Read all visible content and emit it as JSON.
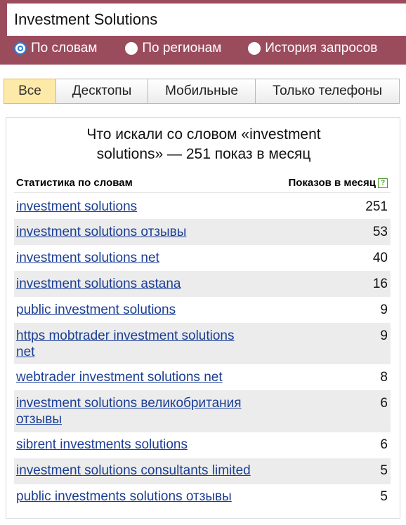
{
  "search": {
    "value": "Investment Solutions",
    "options": [
      {
        "label": "По словам",
        "checked": true
      },
      {
        "label": "По регионам",
        "checked": false
      },
      {
        "label": "История запросов",
        "checked": false
      }
    ]
  },
  "tabs": [
    {
      "label": "Все",
      "active": true
    },
    {
      "label": "Десктопы",
      "active": false
    },
    {
      "label": "Мобильные",
      "active": false
    },
    {
      "label": "Только телефоны",
      "active": false
    }
  ],
  "panel": {
    "title_line1": "Что искали со словом «investment",
    "title_line2": "solutions» — 251 показ в месяц",
    "col_left": "Статистика по словам",
    "col_right": "Показов в месяц",
    "help_icon": "question-icon",
    "help_glyph": "?"
  },
  "rows": [
    {
      "query": "investment solutions",
      "count": "251"
    },
    {
      "query": "investment solutions отзывы",
      "count": "53"
    },
    {
      "query": "investment solutions net",
      "count": "40"
    },
    {
      "query": "investment solutions astana",
      "count": "16"
    },
    {
      "query": "public investment solutions",
      "count": "9"
    },
    {
      "query": "https mobtrader investment solutions net",
      "count": "9"
    },
    {
      "query": "webtrader investment solutions net",
      "count": "8"
    },
    {
      "query": "investment solutions великобритания отзывы",
      "count": "6"
    },
    {
      "query": "sibrent investments solutions",
      "count": "6"
    },
    {
      "query": "investment solutions consultants limited",
      "count": "5"
    },
    {
      "query": "public investments solutions отзывы",
      "count": "5"
    }
  ],
  "colors": {
    "header_bg": "#9b4c5c",
    "link": "#1a3e95",
    "active_tab": "#fde9a8",
    "row_alt": "#ececec"
  }
}
